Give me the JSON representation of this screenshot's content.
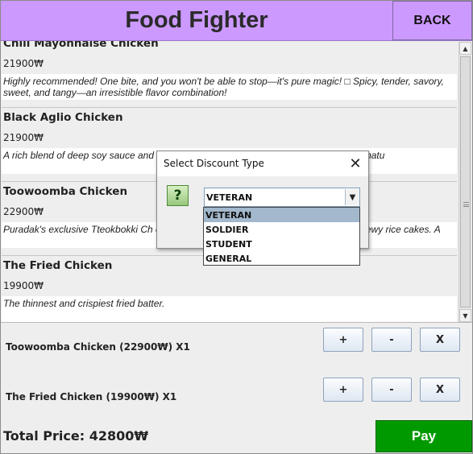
{
  "header": {
    "title": "Food Fighter",
    "back_label": "BACK"
  },
  "menu_items": [
    {
      "name": "Chili Mayonnaise Chicken",
      "price": "21900₩",
      "description": "Highly recommended! One bite, and you won't be able to stop—it's pure magic! □ Spicy, tender, savory, sweet, and tangy—an irresistible flavor combination!"
    },
    {
      "name": "Black Aglio Chicken",
      "price": "21900₩",
      "description": "A rich blend of deep soy sauce and                                     ce a true culinary masterpiece with Puradak's signatu"
    },
    {
      "name": "Toowoomba Chicken",
      "price": "22900₩",
      "description": "Puradak's exclusive Tteokbokki Ch                                      ooth yet fiery Tteokbokki flavor, second with its b                                      ewy rice cakes. A"
    },
    {
      "name": "The Fried Chicken",
      "price": "19900₩",
      "description": "The thinnest and crispiest fried batter."
    }
  ],
  "cart": {
    "items": [
      {
        "label": "Toowoomba Chicken (22900₩) X1"
      },
      {
        "label": "The Fried Chicken (19900₩) X1"
      }
    ],
    "buttons": {
      "plus": "+",
      "minus": "-",
      "remove": "X"
    }
  },
  "footer": {
    "total": "Total Price: 42800₩",
    "pay_label": "Pay"
  },
  "dialog": {
    "title": "Select Discount Type",
    "close_glyph": "✕",
    "icon_glyph": "?",
    "selected": "VETERAN",
    "arrow_glyph": "▼",
    "options": [
      "VETERAN",
      "SOLDIER",
      "STUDENT",
      "GENERAL"
    ]
  },
  "scrollbar": {
    "up_glyph": "▲",
    "down_glyph": "▼"
  },
  "colors": {
    "header": "#CC99FF",
    "pay": "#009900",
    "selected_option": "#A3B8CC",
    "help_icon": "#97c77b"
  }
}
